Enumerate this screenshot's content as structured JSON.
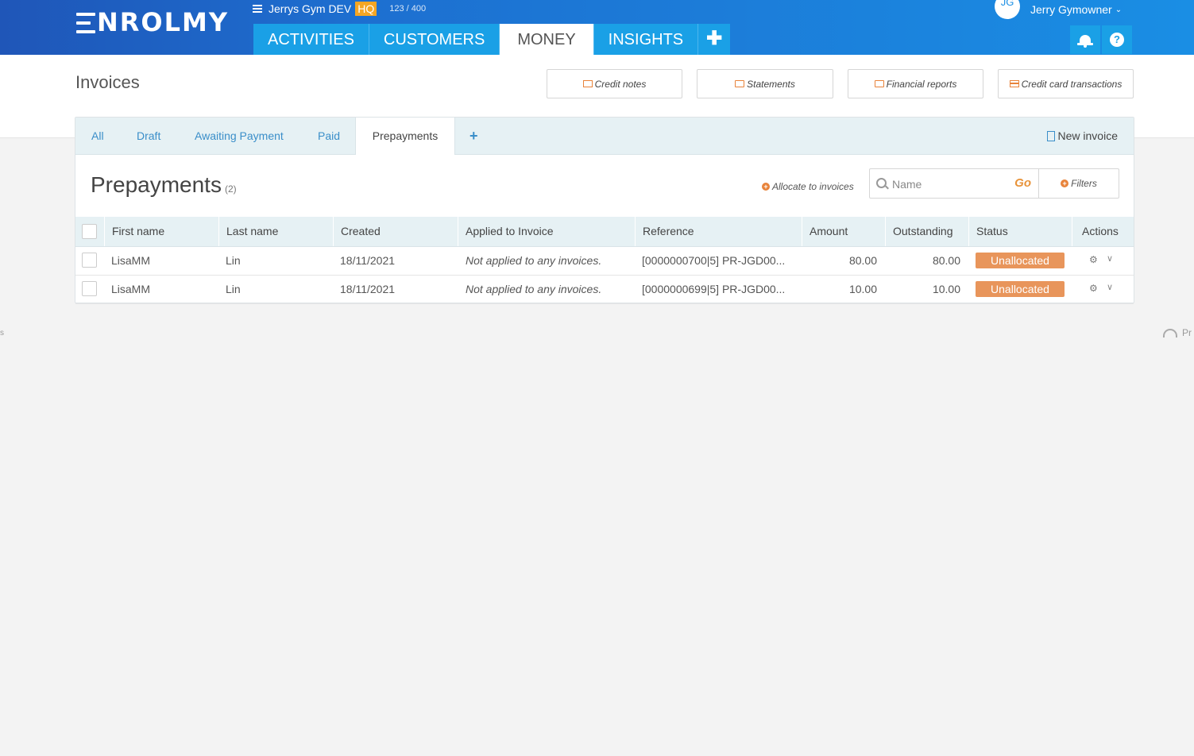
{
  "header": {
    "logo_text": "NROLMY",
    "gym_name": "Jerrys Gym DEV",
    "hq_badge": "HQ",
    "gym_count": "123 / 400",
    "nav": [
      "ACTIVITIES",
      "CUSTOMERS",
      "MONEY",
      "INSIGHTS"
    ],
    "nav_plus": "✚",
    "active_nav": "MONEY",
    "user_initials": "JG",
    "user_name": "Jerry Gymowner",
    "help_label": "?"
  },
  "page": {
    "title": "Invoices",
    "tools": [
      "Credit notes",
      "Statements",
      "Financial reports",
      "Credit card transactions"
    ]
  },
  "subtabs": {
    "items": [
      "All",
      "Draft",
      "Awaiting Payment",
      "Paid",
      "Prepayments"
    ],
    "active": "Prepayments",
    "plus": "+",
    "new_invoice": "New invoice"
  },
  "section": {
    "title": "Prepayments",
    "count": "(2)",
    "allocate_label": "Allocate to invoices",
    "search_placeholder": "Name",
    "go_label": "Go",
    "filters_label": "Filters"
  },
  "table": {
    "columns": [
      "First name",
      "Last name",
      "Created",
      "Applied to Invoice",
      "Reference",
      "Amount",
      "Outstanding",
      "Status",
      "Actions"
    ],
    "rows": [
      {
        "first": "LisaMM",
        "last": "Lin",
        "created": "18/11/2021",
        "applied": "Not applied to any invoices.",
        "reference": "[0000000700|5] PR-JGD00...",
        "amount": "80.00",
        "outstanding": "80.00",
        "status": "Unallocated"
      },
      {
        "first": "LisaMM",
        "last": "Lin",
        "created": "18/11/2021",
        "applied": "Not applied to any invoices.",
        "reference": "[0000000699|5] PR-JGD00...",
        "amount": "10.00",
        "outstanding": "10.00",
        "status": "Unallocated"
      }
    ]
  },
  "misc": {
    "left_edge": "s",
    "right_edge": "Pr"
  },
  "colors": {
    "header_start": "#1f56b8",
    "header_end": "#1a8ee4",
    "nav_tab": "#1aa0e6",
    "hq_badge": "#f5a623",
    "status_unallocated": "#e8955b",
    "link_blue": "#3a8ec9",
    "accent_orange": "#e8833a"
  }
}
